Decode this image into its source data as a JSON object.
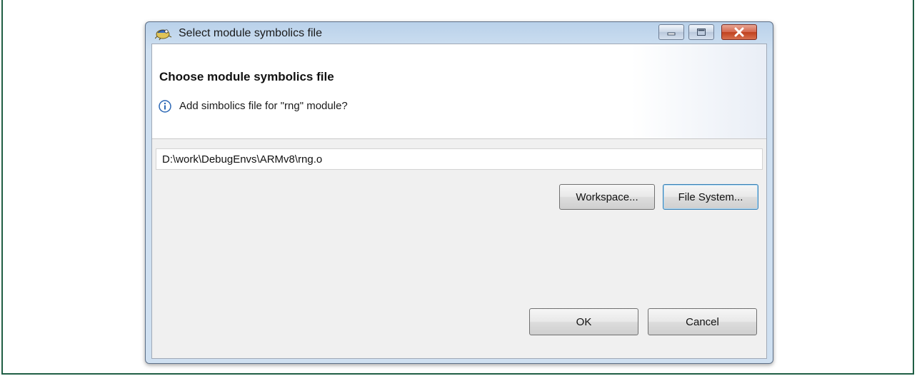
{
  "window": {
    "title": "Select module symbolics file"
  },
  "header": {
    "title": "Choose module symbolics file",
    "message": "Add simbolics file for \"rng\" module?"
  },
  "path_field": {
    "value": "D:\\work\\DebugEnvs\\ARMv8\\rng.o"
  },
  "buttons": {
    "workspace": "Workspace...",
    "file_system": "File System...",
    "ok": "OK",
    "cancel": "Cancel"
  },
  "icons": {
    "app": "eclipse-bug-icon",
    "info": "info-icon",
    "minimize": "minimize-icon",
    "maximize": "maximize-icon",
    "close": "close-icon"
  },
  "colors": {
    "frame_border": "#1f5e45",
    "titlebar": "#b9d1ea",
    "close_button": "#c0411f",
    "default_button_border": "#3c7fb1"
  }
}
